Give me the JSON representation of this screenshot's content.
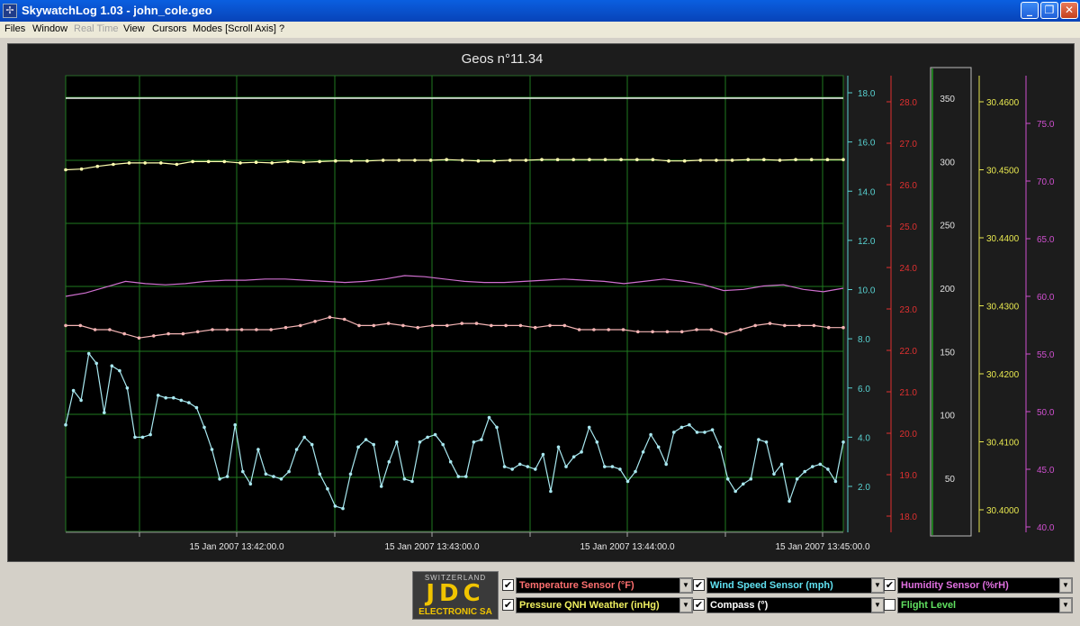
{
  "window": {
    "title": "SkywatchLog 1.03 - john_cole.geo",
    "app_icon": "crosshair-icon",
    "controls": [
      "minimize-icon",
      "restore-icon",
      "close-icon"
    ]
  },
  "menu": [
    {
      "label": "Files",
      "enabled": true
    },
    {
      "label": "Window",
      "enabled": true
    },
    {
      "label": "Real Time",
      "enabled": false
    },
    {
      "label": "View",
      "enabled": true
    },
    {
      "label": "Cursors",
      "enabled": true
    },
    {
      "label": "Modes [Scroll Axis]",
      "enabled": true
    },
    {
      "label": "?",
      "enabled": true
    }
  ],
  "chart_data": {
    "type": "line",
    "title": "Geos n°11.34",
    "x_ticks": [
      "15 Jan 2007 13:42:00.0",
      "15 Jan 2007 13:43:00.0",
      "15 Jan 2007 13:44:00.0",
      "15 Jan 2007 13:45:00.0"
    ],
    "grid": true,
    "axes": [
      {
        "id": "wind",
        "color": "#58d2d2",
        "ticks": [
          "18.0",
          "16.0",
          "14.0",
          "12.0",
          "10.0",
          "8.0",
          "6.0",
          "4.0",
          "2.0"
        ]
      },
      {
        "id": "temp",
        "color": "#e03030",
        "ticks": [
          "28.0",
          "27.0",
          "26.0",
          "25.0",
          "24.0",
          "23.0",
          "22.0",
          "21.0",
          "20.0",
          "19.0",
          "18.0"
        ]
      },
      {
        "id": "compass",
        "color": "#e0e0e0",
        "ticks": [
          "350",
          "300",
          "250",
          "200",
          "150",
          "100",
          "50"
        ]
      },
      {
        "id": "pressure",
        "color": "#e8e850",
        "ticks": [
          "30.4600",
          "30.4500",
          "30.4400",
          "30.4300",
          "30.4200",
          "30.4100",
          "30.4000"
        ]
      },
      {
        "id": "humidity",
        "color": "#d050d0",
        "ticks": [
          "75.0",
          "70.0",
          "65.0",
          "60.0",
          "55.0",
          "50.0",
          "45.0",
          "40.0"
        ]
      }
    ],
    "series": [
      {
        "name": "Temperature Sensor (°F)",
        "axis": "temp",
        "color": "#f4b4b4",
        "markers": true,
        "values": [
          22.6,
          22.6,
          22.5,
          22.5,
          22.4,
          22.3,
          22.35,
          22.4,
          22.4,
          22.45,
          22.5,
          22.5,
          22.5,
          22.5,
          22.5,
          22.55,
          22.6,
          22.7,
          22.8,
          22.75,
          22.6,
          22.6,
          22.65,
          22.6,
          22.55,
          22.6,
          22.6,
          22.65,
          22.65,
          22.6,
          22.6,
          22.6,
          22.55,
          22.6,
          22.6,
          22.5,
          22.5,
          22.5,
          22.5,
          22.45,
          22.45,
          22.45,
          22.45,
          22.5,
          22.5,
          22.4,
          22.5,
          22.6,
          22.65,
          22.6,
          22.6,
          22.6,
          22.55,
          22.55
        ]
      },
      {
        "name": "Pressure QNH Weather (inHg)",
        "axis": "pressure",
        "color": "#ffffb0",
        "markers": true,
        "values": [
          30.45,
          30.4501,
          30.4505,
          30.4508,
          30.451,
          30.451,
          30.451,
          30.4508,
          30.4512,
          30.4512,
          30.4512,
          30.451,
          30.4511,
          30.451,
          30.4512,
          30.4511,
          30.4512,
          30.4513,
          30.4513,
          30.4513,
          30.4514,
          30.4514,
          30.4514,
          30.4514,
          30.4515,
          30.4514,
          30.4513,
          30.4513,
          30.4514,
          30.4514,
          30.4515,
          30.4515,
          30.4515,
          30.4515,
          30.4515,
          30.4515,
          30.4515,
          30.4515,
          30.4513,
          30.4513,
          30.4514,
          30.4514,
          30.4514,
          30.4515,
          30.4515,
          30.4514,
          30.4515,
          30.4515,
          30.4515,
          30.4515
        ]
      },
      {
        "name": "Humidity Sensor (%rH)",
        "axis": "humidity",
        "color": "#d070d0",
        "markers": false,
        "values": [
          60.0,
          60.3,
          60.8,
          61.3,
          61.1,
          61.0,
          61.1,
          61.3,
          61.4,
          61.4,
          61.5,
          61.5,
          61.4,
          61.3,
          61.2,
          61.3,
          61.5,
          61.8,
          61.7,
          61.5,
          61.3,
          61.2,
          61.2,
          61.3,
          61.4,
          61.5,
          61.4,
          61.3,
          61.1,
          61.3,
          61.5,
          61.3,
          61.0,
          60.5,
          60.6,
          60.9,
          61.0,
          60.6,
          60.4,
          60.7
        ]
      },
      {
        "name": "Wind Speed Sensor (mph)",
        "axis": "wind",
        "color": "#a8e8f0",
        "markers": true,
        "values": [
          4.5,
          5.9,
          5.5,
          7.4,
          7.0,
          5.0,
          6.9,
          6.7,
          6.0,
          4.0,
          4.0,
          4.1,
          5.7,
          5.6,
          5.6,
          5.5,
          5.4,
          5.2,
          4.4,
          3.5,
          2.3,
          2.4,
          4.5,
          2.6,
          2.1,
          3.5,
          2.5,
          2.4,
          2.3,
          2.6,
          3.5,
          4.0,
          3.7,
          2.5,
          1.9,
          1.2,
          1.1,
          2.5,
          3.6,
          3.9,
          3.7,
          2.0,
          3.0,
          3.8,
          2.3,
          2.2,
          3.8,
          4.0,
          4.1,
          3.7,
          3.0,
          2.4,
          2.4,
          3.8,
          3.9,
          4.8,
          4.4,
          2.8,
          2.7,
          2.9,
          2.8,
          2.7,
          3.3,
          1.8,
          3.6,
          2.8,
          3.2,
          3.4,
          4.4,
          3.8,
          2.8,
          2.8,
          2.7,
          2.2,
          2.6,
          3.4,
          4.1,
          3.6,
          2.9,
          4.2,
          4.4,
          4.5,
          4.2,
          4.2,
          4.3,
          3.6,
          2.3,
          1.8,
          2.1,
          2.3,
          3.9,
          3.8,
          2.5,
          2.9,
          1.4,
          2.3,
          2.6,
          2.8,
          2.9,
          2.7,
          2.2,
          3.8
        ]
      },
      {
        "name": "Compass (°)",
        "axis": "compass",
        "color": "#f0f0f0",
        "markers": false,
        "values": [
          350,
          350,
          350,
          350,
          350,
          350,
          350,
          350,
          350,
          350
        ]
      }
    ]
  },
  "logo": {
    "top": "SWITZERLAND",
    "main": "JDC",
    "bottom": "ELECTRONIC SA"
  },
  "sensors": [
    {
      "label": "Temperature Sensor (°F)",
      "checked": true,
      "color": "#ff7070"
    },
    {
      "label": "Wind Speed Sensor (mph)",
      "checked": true,
      "color": "#60e0f0"
    },
    {
      "label": "Humidity Sensor (%rH)",
      "checked": true,
      "color": "#e070e0"
    },
    {
      "label": "Pressure QNH Weather (inHg)",
      "checked": true,
      "color": "#f0f060"
    },
    {
      "label": "Compass (°)",
      "checked": true,
      "color": "#ffffff"
    },
    {
      "label": "Flight Level",
      "checked": false,
      "color": "#60e060"
    }
  ]
}
